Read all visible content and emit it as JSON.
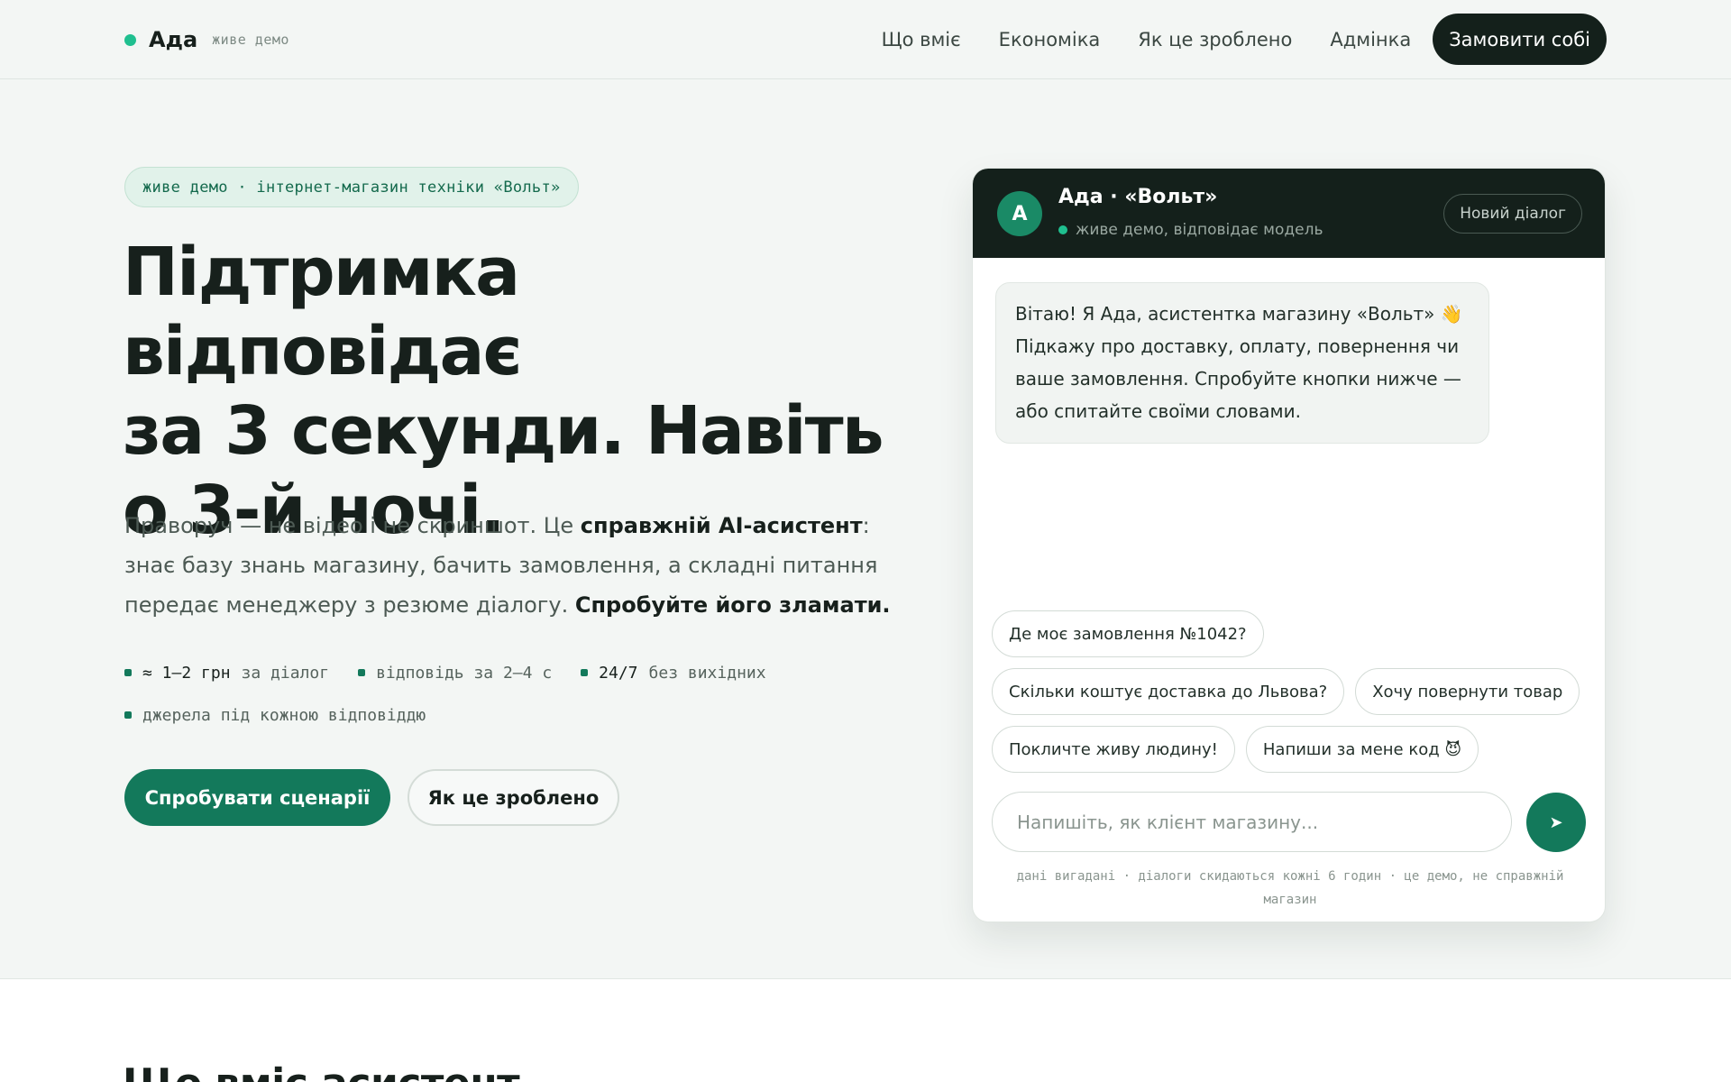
{
  "header": {
    "brand_name": "Ада",
    "brand_tag": "живе демо",
    "nav": [
      "Що вміє",
      "Економіка",
      "Як це зроблено",
      "Адмінка"
    ],
    "cta": "Замовити собі"
  },
  "hero": {
    "pill": "живе демо · інтернет-магазин техніки «Вольт»",
    "headline_lines": [
      "Підтримка відповідає",
      "за 3 секунди. Навіть",
      "о 3-й ночі."
    ],
    "lead": {
      "part1": "Праворуч — не відео і не скриншот. Це ",
      "strong1": "справжній AI-асистент",
      "part2": ": знає базу знань магазину, бачить замовлення, а складні питання передає менеджеру з резюме діалогу. ",
      "strong2": "Спробуйте його зламати."
    },
    "features": [
      {
        "strong": "≈ 1–2 грн",
        "text": "за діалог"
      },
      {
        "strong": "",
        "text": "відповідь за 2–4 с"
      },
      {
        "strong": "24/7",
        "text": "без вихідних"
      },
      {
        "strong": "",
        "text": "джерела під кожною відповіддю"
      }
    ],
    "primary_button": "Спробувати сценарії",
    "secondary_button": "Як це зроблено"
  },
  "chat": {
    "avatar_letter": "А",
    "title": "Ада · «Вольт»",
    "status": "живе демо, відповідає модель",
    "new_dialog": "Новий діалог",
    "greeting": "Вітаю! Я Ада, асистентка магазину «Вольт» 👋 Підкажу про доставку, оплату, повернення чи ваше замовлення. Спробуйте кнопки нижче — або спитайте своїми словами.",
    "suggestions": [
      "Де моє замовлення №1042?",
      "Скільки коштує доставка до Львова?",
      "Хочу повернути товар",
      "Покличте живу людину!",
      "Напиши за мене код 😈"
    ],
    "input_placeholder": "Напишіть, як клієнт магазину...",
    "send_icon": "➤",
    "disclaimer": "дані вигадані · діалоги скидаються кожні 6 годин · це демо, не справжній магазин"
  },
  "section2": {
    "title": "Що вміє асистент"
  }
}
